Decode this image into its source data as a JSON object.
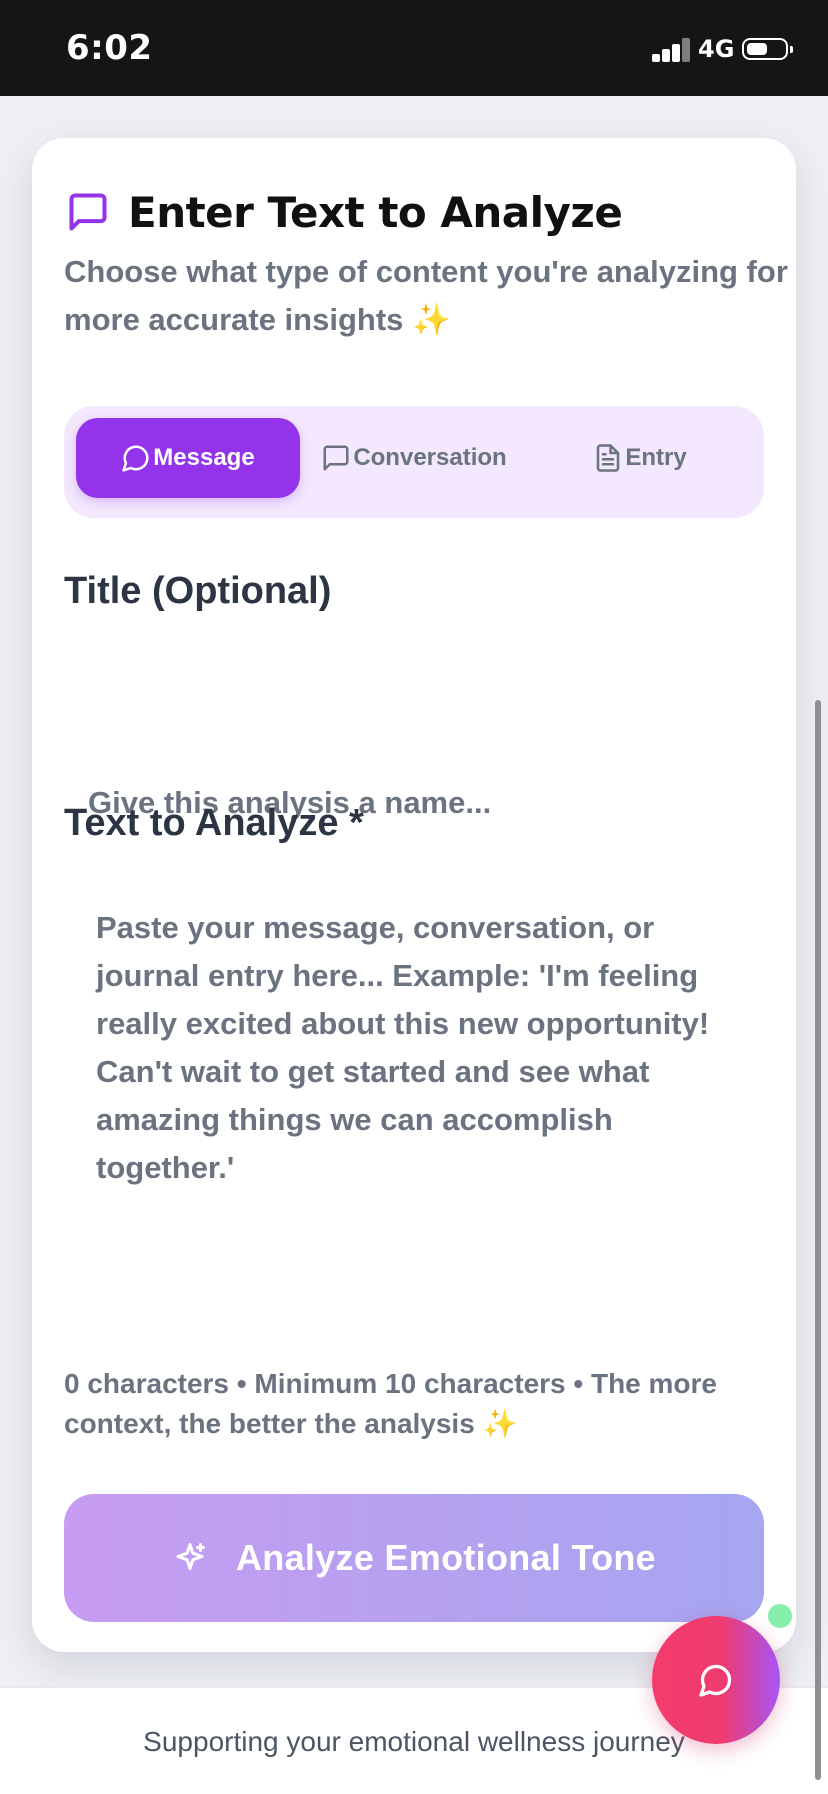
{
  "status_bar": {
    "time": "6:02",
    "network": "4G"
  },
  "card": {
    "heading": "Enter Text to Analyze",
    "subtitle": "Choose what type of content you're analyzing for more accurate insights ✨",
    "tabs": [
      {
        "label": "Message",
        "icon": "message-circle-icon",
        "active": true
      },
      {
        "label": "Conversation",
        "icon": "message-square-icon",
        "active": false
      },
      {
        "label": "Entry",
        "icon": "file-text-icon",
        "active": false
      }
    ],
    "title_field": {
      "label": "Title (Optional)",
      "placeholder": "Give this analysis a name...",
      "value": ""
    },
    "text_field": {
      "label": "Text to Analyze *",
      "placeholder": "Paste your message, conversation, or journal entry here... Example: 'I'm feeling really excited about this new opportunity! Can't wait to get started and see what amazing things we can accomplish together.'",
      "value": ""
    },
    "helper_text": "0 characters • Minimum 10 characters • The more context, the better the analysis ✨",
    "analyze_button": {
      "label": "Analyze Emotional Tone",
      "icon": "sparkles-icon"
    }
  },
  "footer": {
    "text": "Supporting your emotional wellness journey"
  },
  "chat_fab": {
    "icon": "chat-bubble-icon"
  },
  "colors": {
    "accent": "#9333ea",
    "tab_bg": "#f3e8fd",
    "fab_start": "#f53b6c",
    "fab_end": "#a855f7"
  }
}
